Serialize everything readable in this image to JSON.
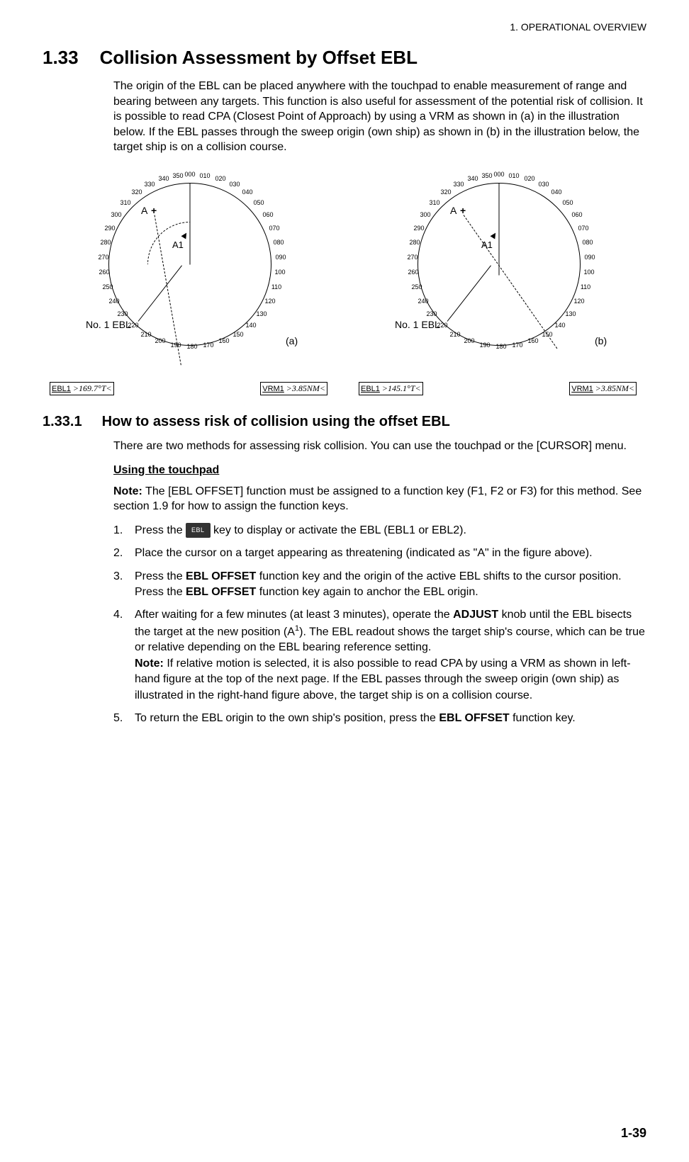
{
  "header": {
    "chapter": "1.  OPERATIONAL OVERVIEW"
  },
  "section": {
    "num": "1.33",
    "title": "Collision Assessment by Offset EBL",
    "intro": "The origin of the EBL can be placed anywhere with the touchpad to enable measurement of range and bearing between any targets. This function is also useful for assessment of the potential risk of collision. It is possible to read CPA (Closest Point of Approach) by using a VRM as shown in (a) in the illustration below. If the EBL passes through the sweep origin (own ship) as shown in (b) in the illustration below, the target ship is on a collision course."
  },
  "figure": {
    "compass_labels": [
      "000",
      "010",
      "020",
      "030",
      "040",
      "050",
      "060",
      "070",
      "080",
      "090",
      "100",
      "110",
      "120",
      "130",
      "140",
      "150",
      "160",
      "170",
      "180",
      "190",
      "200",
      "210",
      "220",
      "230",
      "240",
      "250",
      "260",
      "270",
      "280",
      "290",
      "300",
      "310",
      "320",
      "330",
      "340",
      "350"
    ],
    "a": {
      "side_label": "No. 1 EBL",
      "tag": "(a)",
      "A_label": "A",
      "A1_label": "A1",
      "ebl_box": {
        "lab": "EBL1",
        "val": ">169.7°T<"
      },
      "vrm_box": {
        "lab": "VRM1",
        "val": ">3.85NM<"
      }
    },
    "b": {
      "side_label": "No. 1 EBL",
      "tag": "(b)",
      "A_label": "A",
      "A1_label": "A1",
      "ebl_box": {
        "lab": "EBL1",
        "val": ">145.1°T<"
      },
      "vrm_box": {
        "lab": "VRM1",
        "val": ">3.85NM<"
      }
    }
  },
  "subsection": {
    "num": "1.33.1",
    "title": "How to assess risk of collision using the offset EBL",
    "intro": "There are two methods for assessing risk collision. You can use the touchpad or the [CURSOR] menu.",
    "sub_head": "Using the touchpad",
    "note_label": "Note:",
    "note_text": " The [EBL OFFSET] function must be assigned to a function key (F1, F2 or F3) for this method. See section 1.9 for how to assign the function keys.",
    "key_label": "EBL",
    "step1_pre": "Press the ",
    "step1_post": " key to display or activate the EBL (EBL1 or EBL2).",
    "step2": "Place the cursor on a target appearing as threatening (indicated as \"A\" in the figure above).",
    "step3_a": "Press the ",
    "step3_b": "EBL OFFSET",
    "step3_c": " function key and the origin of the active EBL shifts to the cursor position. Press the ",
    "step3_d": "EBL OFFSET",
    "step3_e": " function key again to anchor the EBL origin.",
    "step4_a": "After waiting for a few minutes (at least 3 minutes), operate the ",
    "step4_b": "ADJUST",
    "step4_c": " knob until the EBL bisects the target at the new position (A",
    "step4_d": "). The EBL readout shows the target ship's course, which can be true or relative depending on the EBL bearing reference setting.",
    "step4_note_label": "Note:",
    "step4_note": " If relative motion is selected, it is also possible to read CPA by using a VRM as shown in left-hand figure at the top of the next page. If the EBL passes through the sweep origin (own ship) as illustrated in the right-hand figure above, the target ship is on a collision course.",
    "step5_a": "To return the EBL origin to the own ship's position, press the ",
    "step5_b": "EBL OFFSET",
    "step5_c": " function key.",
    "sup1": "1"
  },
  "page": "1-39"
}
